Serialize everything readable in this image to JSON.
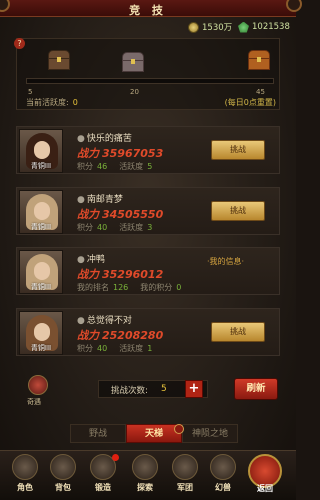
{
  "header": {
    "title": "竞 技"
  },
  "currency": {
    "gold": "1530万",
    "gems": "1021538"
  },
  "activity": {
    "help": "?",
    "ticks": [
      "5",
      "20",
      "45"
    ],
    "label": "当前活跃度:",
    "value": "0",
    "reset": "(每日0点重置)"
  },
  "opponents": [
    {
      "name": "快乐的痛苦",
      "power_label": "战力",
      "power": "35967053",
      "points_label": "积分",
      "points": "46",
      "active_label": "活跃度",
      "active": "5",
      "level": "青铜III",
      "button": "挑战",
      "hair": "#3a2014"
    },
    {
      "name": "南邮青梦",
      "power_label": "战力",
      "power": "34505550",
      "points_label": "积分",
      "points": "40",
      "active_label": "活跃度",
      "active": "3",
      "level": "青铜III",
      "button": "挑战",
      "hair": "#c0a27a"
    },
    {
      "name": "冲鸭",
      "power_label": "战力",
      "power": "35296012",
      "points_label": "我的排名",
      "points": "126",
      "active_label": "我的积分",
      "active": "0",
      "level": "青铜III",
      "myinfo": "·我的信息·",
      "hair": "#c0a27a"
    },
    {
      "name": "总觉得不对",
      "power_label": "战力",
      "power": "25208280",
      "points_label": "积分",
      "points": "40",
      "active_label": "活跃度",
      "active": "1",
      "level": "青铜III",
      "button": "挑战",
      "hair": "#7a5030"
    }
  ],
  "controls": {
    "avatar_label": "奇遇",
    "challenge_label": "挑战次数:",
    "challenge_value": "5",
    "plus": "+",
    "refresh": "刷新"
  },
  "tabs": [
    "野战",
    "天梯",
    "神陨之地"
  ],
  "nav": [
    {
      "label": "角色",
      "icon": "helmet-icon"
    },
    {
      "label": "背包",
      "icon": "bag-icon"
    },
    {
      "label": "锻造",
      "icon": "anvil-icon"
    },
    {
      "label": "探索",
      "icon": "explore-icon"
    },
    {
      "label": "军团",
      "icon": "legion-icon"
    },
    {
      "label": "幻兽",
      "icon": "beast-icon"
    }
  ],
  "back": "返回"
}
